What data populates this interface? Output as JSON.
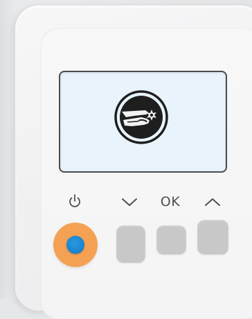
{
  "device": {
    "display": {
      "icon": "hand-with-spark-icon"
    },
    "controls": {
      "power": {
        "icon": "power-icon"
      },
      "down": {
        "icon": "chevron-down-icon"
      },
      "ok": {
        "label": "OK"
      },
      "up": {
        "icon": "chevron-up-icon"
      }
    },
    "colors": {
      "power_button": "#f5a154",
      "power_led": "#1a86cf",
      "keys": "#c8c8c9",
      "lcd_background": "#e8f3fb",
      "lcd_border": "#4a4c50"
    }
  }
}
